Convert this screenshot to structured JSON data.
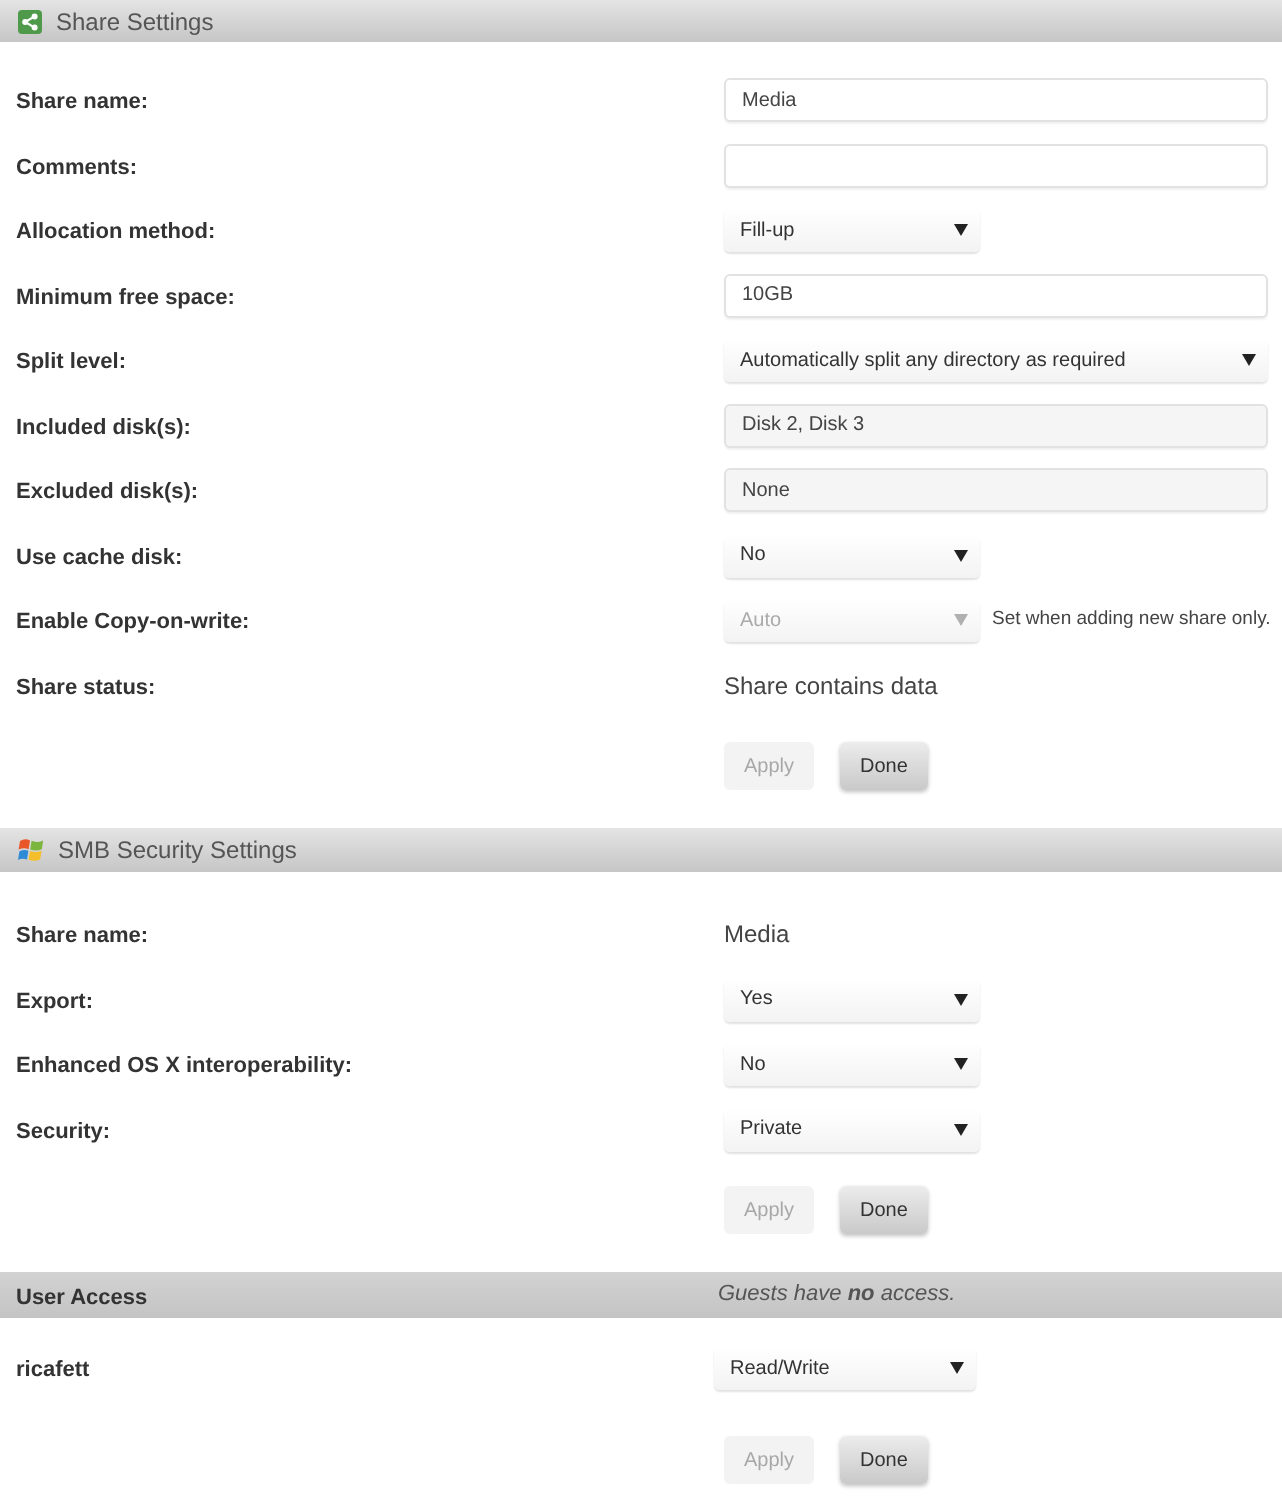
{
  "sections": [
    {
      "title": "Share Settings",
      "fields": [
        {
          "label": "Share name:",
          "kind": "input",
          "value": "Media"
        },
        {
          "label": "Comments:",
          "kind": "input"
        },
        {
          "label": "Allocation method:",
          "kind": "select",
          "value": "Fill-up",
          "disabled": false
        },
        {
          "label": "Minimum free space:",
          "kind": "input",
          "value": "10GB"
        },
        {
          "label": "Split level:",
          "kind": "longselect",
          "value": "Automatically split any directory as required",
          "disabled": false
        },
        {
          "label": "Included disk(s):",
          "kind": "readonly",
          "value": "Disk 2, Disk 3"
        },
        {
          "label": "Excluded disk(s):",
          "kind": "readonly",
          "value": "None"
        },
        {
          "label": "Use cache disk:",
          "kind": "select",
          "value": "No",
          "disabled": false
        },
        {
          "label": "Enable Copy-on-write:",
          "kind": "select",
          "value": "Auto",
          "disabled": true,
          "note": "Set when adding new share only."
        },
        {
          "label": "Share status:",
          "kind": "text",
          "value": "Share contains data"
        }
      ],
      "buttons": [
        {
          "label": "Apply",
          "disabled": true
        },
        {
          "label": "Done",
          "disabled": false
        }
      ]
    },
    {
      "title": "SMB Security Settings",
      "fields": [
        {
          "label": "Share name:",
          "kind": "text",
          "value": "Media"
        },
        {
          "label": "Export:",
          "kind": "select",
          "value": "Yes",
          "disabled": false
        },
        {
          "label": "Enhanced OS X interoperability:",
          "kind": "select",
          "value": "No",
          "disabled": false
        },
        {
          "label": "Security:",
          "kind": "select",
          "value": "Private",
          "disabled": false
        }
      ],
      "buttons": [
        {
          "label": "Apply",
          "disabled": true
        },
        {
          "label": "Done",
          "disabled": false
        }
      ]
    }
  ],
  "user_access": {
    "title": "User Access",
    "note": "Guests have **no** access.",
    "users": [
      {
        "name": "ricafett",
        "access": "Read/Write"
      }
    ],
    "buttons": [
      {
        "label": "Apply",
        "disabled": true
      },
      {
        "label": "Done",
        "disabled": false
      }
    ]
  }
}
